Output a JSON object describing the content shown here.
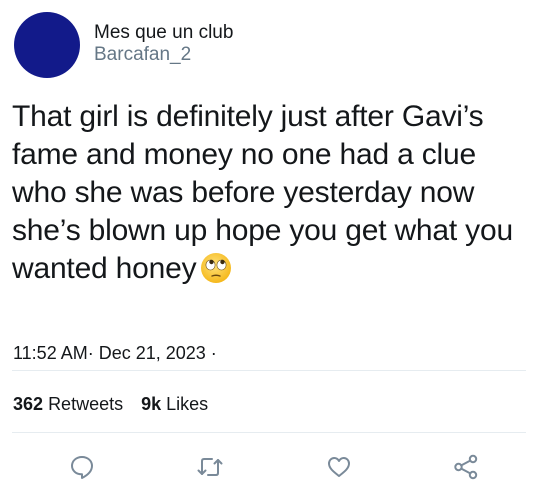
{
  "user": {
    "display_name": "Mes que un club",
    "handle": "Barcafan_2",
    "avatar_color": "#121a8a"
  },
  "tweet": {
    "text": "That girl is definitely just after Gavi’s fame and money no one had a clue who she was before yesterday now she’s blown up hope you get what you wanted honey",
    "emoji": "face-with-rolling-eyes",
    "timestamp": "11:52 AM· Dec 21, 2023 ·"
  },
  "stats": {
    "retweets_count": "362",
    "retweets_label": "Retweets",
    "likes_count": "9k",
    "likes_label": "Likes"
  },
  "actions": {
    "icons": [
      "comment-icon",
      "retweet-icon",
      "like-icon",
      "share-icon"
    ],
    "icon_color": "#7a8a99"
  }
}
